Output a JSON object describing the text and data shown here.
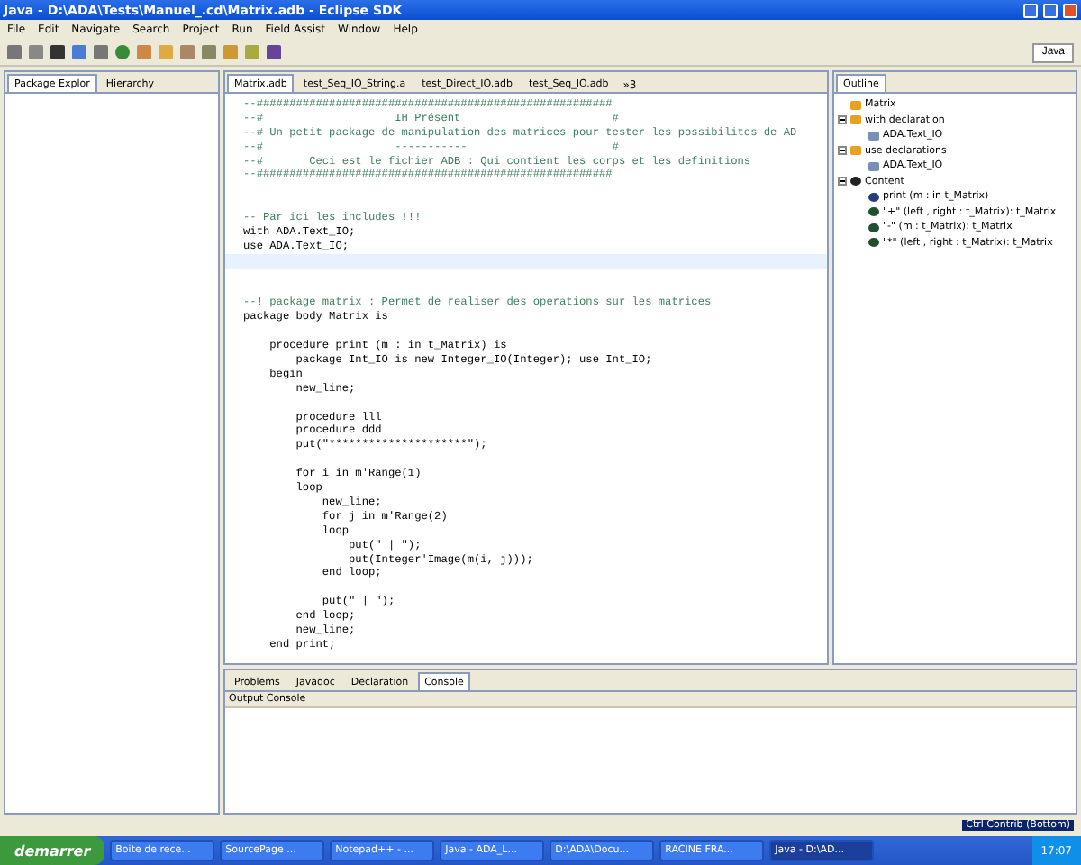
{
  "window": {
    "title": "Java - D:\\ADA\\Tests\\Manuel_.cd\\Matrix.adb - Eclipse SDK"
  },
  "menu": [
    "File",
    "Edit",
    "Navigate",
    "Search",
    "Project",
    "Run",
    "Field Assist",
    "Window",
    "Help"
  ],
  "perspective": {
    "label": "Java"
  },
  "left_tabs": [
    {
      "label": "Package Explor",
      "selected": true
    },
    {
      "label": "Hierarchy",
      "selected": false
    }
  ],
  "editor_tabs": [
    {
      "label": "Matrix.adb",
      "selected": true
    },
    {
      "label": "test_Seq_IO_String.a",
      "selected": false
    },
    {
      "label": "test_Direct_IO.adb",
      "selected": false
    },
    {
      "label": "test_Seq_IO.adb",
      "selected": false
    }
  ],
  "editor_overflow": "»3",
  "code_lines": [
    {
      "kind": "comment",
      "text": "--######################################################"
    },
    {
      "kind": "comment",
      "text": "--#                    IH Présent                       #"
    },
    {
      "kind": "comment",
      "text": "--# Un petit package de manipulation des matrices pour tester les possibilites de AD"
    },
    {
      "kind": "comment",
      "text": "--#                    -----------                      #"
    },
    {
      "kind": "comment",
      "text": "--#       Ceci est le fichier ADB : Qui contient les corps et les definitions"
    },
    {
      "kind": "comment",
      "text": "--######################################################"
    },
    {
      "kind": "blank"
    },
    {
      "kind": "blank"
    },
    {
      "kind": "comment",
      "text": "-- Par ici les includes !!!"
    },
    {
      "kind": "code",
      "text": "with ADA.Text_IO;"
    },
    {
      "kind": "code",
      "text": "use ADA.Text_IO;"
    },
    {
      "kind": "blank",
      "current": true
    },
    {
      "kind": "blank"
    },
    {
      "kind": "blank"
    },
    {
      "kind": "comment",
      "text": "--! package matrix : Permet de realiser des operations sur les matrices"
    },
    {
      "kind": "code",
      "text": "package body Matrix is"
    },
    {
      "kind": "blank"
    },
    {
      "kind": "code",
      "text": "    procedure print (m : in t_Matrix) is"
    },
    {
      "kind": "code",
      "text": "        package Int_IO is new Integer_IO(Integer); use Int_IO;"
    },
    {
      "kind": "code",
      "text": "    begin"
    },
    {
      "kind": "code",
      "text": "        new_line;"
    },
    {
      "kind": "blank"
    },
    {
      "kind": "code",
      "text": "        procedure lll"
    },
    {
      "kind": "code",
      "text": "        procedure ddd"
    },
    {
      "kind": "code",
      "text": "        put(\"*********************\");"
    },
    {
      "kind": "blank"
    },
    {
      "kind": "code",
      "text": "        for i in m'Range(1)"
    },
    {
      "kind": "code",
      "text": "        loop"
    },
    {
      "kind": "code",
      "text": "            new_line;"
    },
    {
      "kind": "code",
      "text": "            for j in m'Range(2)"
    },
    {
      "kind": "code",
      "text": "            loop"
    },
    {
      "kind": "code",
      "text": "                put(\" | \");"
    },
    {
      "kind": "code",
      "text": "                put(Integer'Image(m(i, j)));"
    },
    {
      "kind": "code",
      "text": "            end loop;"
    },
    {
      "kind": "blank"
    },
    {
      "kind": "code",
      "text": "            put(\" | \");"
    },
    {
      "kind": "code",
      "text": "        end loop;"
    },
    {
      "kind": "code",
      "text": "        new_line;"
    },
    {
      "kind": "code",
      "text": "    end print;"
    }
  ],
  "outline": {
    "title": "Outline",
    "items": [
      {
        "label": "Matrix",
        "kind": "package"
      },
      {
        "label": "with declaration",
        "kind": "package",
        "expanded": true,
        "children": [
          {
            "label": "ADA.Text_IO",
            "kind": "unit"
          }
        ]
      },
      {
        "label": "use declarations",
        "kind": "package",
        "expanded": true,
        "children": [
          {
            "label": "ADA.Text_IO",
            "kind": "unit"
          }
        ]
      },
      {
        "label": "Content",
        "kind": "content",
        "expanded": true,
        "children": [
          {
            "label": "print (m : in t_Matrix)",
            "kind": "proc"
          },
          {
            "label": "\"+\" (left , right : t_Matrix): t_Matrix",
            "kind": "func"
          },
          {
            "label": "\"-\" (m : t_Matrix): t_Matrix",
            "kind": "func"
          },
          {
            "label": "\"*\" (left , right : t_Matrix): t_Matrix",
            "kind": "func"
          }
        ]
      }
    ]
  },
  "bottom_tabs": [
    {
      "label": "Problems",
      "selected": false
    },
    {
      "label": "Javadoc",
      "selected": false
    },
    {
      "label": "Declaration",
      "selected": false
    },
    {
      "label": "Console",
      "selected": true
    }
  ],
  "console_title": "Output Console",
  "status_bar": {
    "hint": "Ctrl Contrib (Bottom)"
  },
  "taskbar": {
    "start": "demarrer",
    "items": [
      {
        "label": "Boite de rece...",
        "selected": false
      },
      {
        "label": "SourcePage ...",
        "selected": false
      },
      {
        "label": "Notepad++ - ...",
        "selected": false
      },
      {
        "label": "Java - ADA_L...",
        "selected": false
      },
      {
        "label": "D:\\ADA\\Docu...",
        "selected": false
      },
      {
        "label": "RACINE FRA...",
        "selected": false
      },
      {
        "label": "Java - D:\\AD...",
        "selected": true
      }
    ],
    "clock": "17:07"
  }
}
